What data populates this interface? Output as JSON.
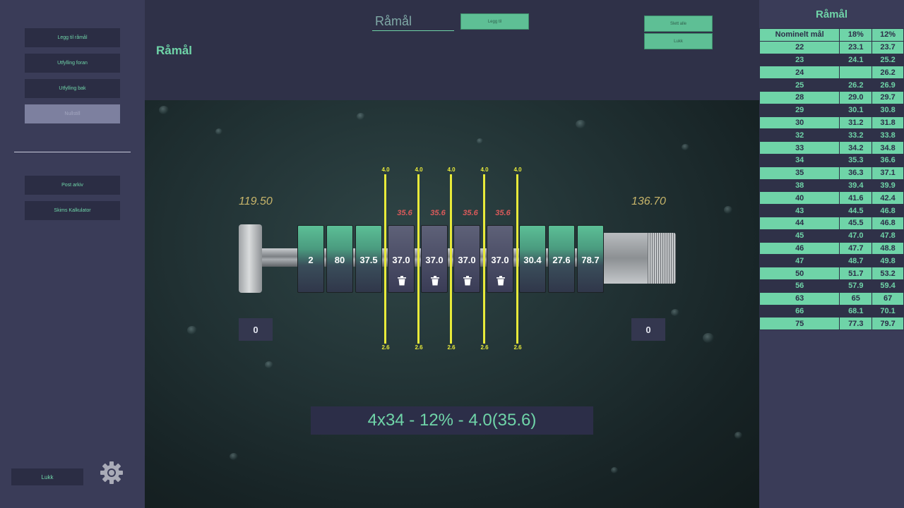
{
  "sidebar": {
    "buttons": [
      {
        "label": "Legg til råmål",
        "active": true
      },
      {
        "label": "Utfylling foran",
        "active": true
      },
      {
        "label": "Utfylling bak",
        "active": true
      },
      {
        "label": "Nullstill",
        "active": false
      }
    ],
    "archive_buttons": [
      {
        "label": "Post arkiv"
      },
      {
        "label": "Skims Kalkulator"
      }
    ],
    "close_label": "Lukk",
    "settings_icon": "gear-icon"
  },
  "header": {
    "title": "Råmål",
    "search_placeholder": "Råmål",
    "add_label": "Legg til",
    "delete_all_label": "Slett alle",
    "close_label": "Lukk"
  },
  "assembly": {
    "left_measure": "119.50",
    "right_measure": "136.70",
    "left_count": "0",
    "right_count": "0",
    "segments": [
      {
        "value": "2",
        "kind": "green"
      },
      {
        "value": "80",
        "kind": "green"
      },
      {
        "value": "37.5",
        "kind": "green"
      },
      {
        "value": "37.0",
        "kind": "gray"
      },
      {
        "value": "37.0",
        "kind": "gray"
      },
      {
        "value": "37.0",
        "kind": "gray"
      },
      {
        "value": "37.0",
        "kind": "gray"
      },
      {
        "value": "30.4",
        "kind": "green"
      },
      {
        "value": "27.6",
        "kind": "green"
      },
      {
        "value": "78.7",
        "kind": "green"
      }
    ],
    "blade_top": "4.0",
    "blade_bottom": "2.6",
    "cut_width": "35.6",
    "result": "4x34 - 12% - 4.0(35.6)"
  },
  "right_panel": {
    "title": "Råmål",
    "columns": [
      "Nominelt mål",
      "18%",
      "12%"
    ],
    "rows": [
      [
        "22",
        "23.1",
        "23.7"
      ],
      [
        "23",
        "24.1",
        "25.2"
      ],
      [
        "24",
        "",
        "26.2"
      ],
      [
        "25",
        "26.2",
        "26.9"
      ],
      [
        "28",
        "29.0",
        "29.7"
      ],
      [
        "29",
        "30.1",
        "30.8"
      ],
      [
        "30",
        "31.2",
        "31.8"
      ],
      [
        "32",
        "33.2",
        "33.8"
      ],
      [
        "33",
        "34.2",
        "34.8"
      ],
      [
        "34",
        "35.3",
        "36.6"
      ],
      [
        "35",
        "36.3",
        "37.1"
      ],
      [
        "38",
        "39.4",
        "39.9"
      ],
      [
        "40",
        "41.6",
        "42.4"
      ],
      [
        "43",
        "44.5",
        "46.8"
      ],
      [
        "44",
        "45.5",
        "46.8"
      ],
      [
        "45",
        "47.0",
        "47.8"
      ],
      [
        "46",
        "47.7",
        "48.8"
      ],
      [
        "47",
        "48.7",
        "49.8"
      ],
      [
        "50",
        "51.7",
        "53.2"
      ],
      [
        "56",
        "57.9",
        "59.4"
      ],
      [
        "63",
        "65",
        "67"
      ],
      [
        "66",
        "68.1",
        "70.1"
      ],
      [
        "75",
        "77.3",
        "79.7"
      ]
    ]
  },
  "colors": {
    "accent": "#6fd4a8",
    "panel": "#3a3c58",
    "background": "#2f3148",
    "blade": "#e8ea3a",
    "cut": "#d95a5a"
  }
}
